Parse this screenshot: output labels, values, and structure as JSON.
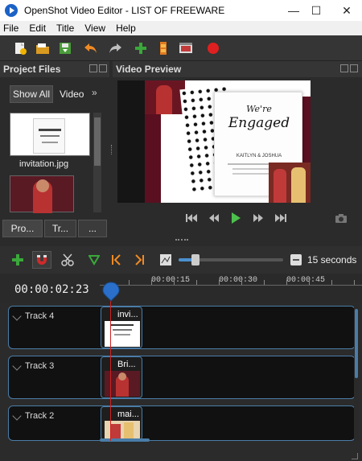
{
  "window": {
    "title": "OpenShot Video Editor - LIST OF FREEWARE",
    "minimize": "—",
    "maximize": "☐",
    "close": "✕"
  },
  "menu": [
    "File",
    "Edit",
    "Title",
    "View",
    "Help"
  ],
  "toolbar_icons": [
    "new-project-icon",
    "open-project-icon",
    "save-project-icon",
    "undo-icon",
    "redo-icon",
    "import-files-icon",
    "choose-profile-icon",
    "export-film-icon",
    "record-icon"
  ],
  "project_files": {
    "header": "Project Files",
    "filter_tabs": [
      "Show All",
      "Video"
    ],
    "more": "»",
    "files": [
      {
        "name": "invitation.jpg"
      },
      {
        "name": ""
      }
    ],
    "bottom_tabs": [
      "Pro...",
      "Tr...",
      "..."
    ]
  },
  "video_preview": {
    "header": "Video Preview",
    "card": {
      "line1": "We're",
      "line2": "Engaged",
      "names": "KAITLYN & JOSHUA"
    }
  },
  "timeline": {
    "timecode": "00:00:02:23",
    "zoom_label": "15 seconds",
    "ruler_labels": [
      "00:00:15",
      "00:00:30",
      "00:00:45"
    ],
    "tracks": [
      {
        "name": "Track 4",
        "clip": "invi..."
      },
      {
        "name": "Track 3",
        "clip": "Bri..."
      },
      {
        "name": "Track 2",
        "clip": "mai..."
      }
    ]
  },
  "colors": {
    "accent": "#4a7da8",
    "playhead": "#cc2222",
    "add_icon": "#3aa83a",
    "record_icon": "#e02020"
  }
}
